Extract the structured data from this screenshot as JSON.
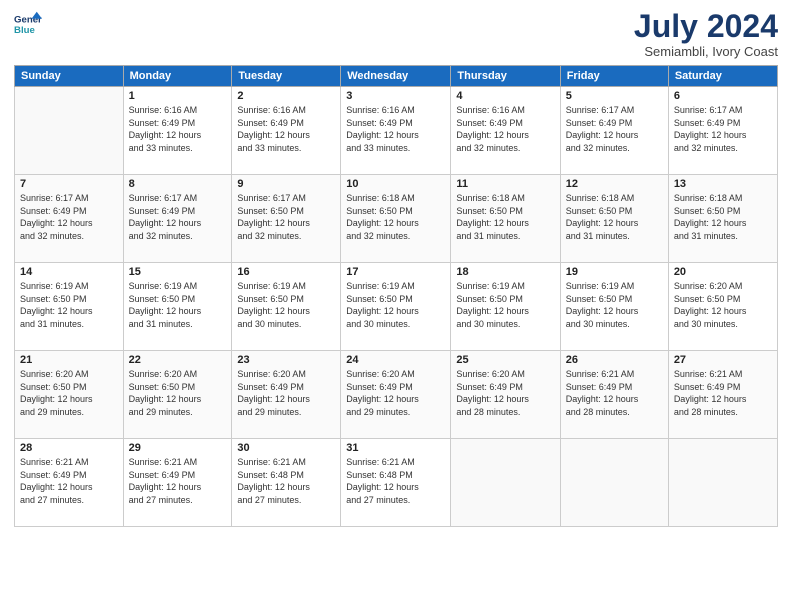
{
  "header": {
    "logo_line1": "General",
    "logo_line2": "Blue",
    "month_year": "July 2024",
    "location": "Semiambli, Ivory Coast"
  },
  "weekdays": [
    "Sunday",
    "Monday",
    "Tuesday",
    "Wednesday",
    "Thursday",
    "Friday",
    "Saturday"
  ],
  "weeks": [
    [
      {
        "day": "",
        "info": ""
      },
      {
        "day": "1",
        "info": "Sunrise: 6:16 AM\nSunset: 6:49 PM\nDaylight: 12 hours\nand 33 minutes."
      },
      {
        "day": "2",
        "info": "Sunrise: 6:16 AM\nSunset: 6:49 PM\nDaylight: 12 hours\nand 33 minutes."
      },
      {
        "day": "3",
        "info": "Sunrise: 6:16 AM\nSunset: 6:49 PM\nDaylight: 12 hours\nand 33 minutes."
      },
      {
        "day": "4",
        "info": "Sunrise: 6:16 AM\nSunset: 6:49 PM\nDaylight: 12 hours\nand 32 minutes."
      },
      {
        "day": "5",
        "info": "Sunrise: 6:17 AM\nSunset: 6:49 PM\nDaylight: 12 hours\nand 32 minutes."
      },
      {
        "day": "6",
        "info": "Sunrise: 6:17 AM\nSunset: 6:49 PM\nDaylight: 12 hours\nand 32 minutes."
      }
    ],
    [
      {
        "day": "7",
        "info": "Sunrise: 6:17 AM\nSunset: 6:49 PM\nDaylight: 12 hours\nand 32 minutes."
      },
      {
        "day": "8",
        "info": "Sunrise: 6:17 AM\nSunset: 6:49 PM\nDaylight: 12 hours\nand 32 minutes."
      },
      {
        "day": "9",
        "info": "Sunrise: 6:17 AM\nSunset: 6:50 PM\nDaylight: 12 hours\nand 32 minutes."
      },
      {
        "day": "10",
        "info": "Sunrise: 6:18 AM\nSunset: 6:50 PM\nDaylight: 12 hours\nand 32 minutes."
      },
      {
        "day": "11",
        "info": "Sunrise: 6:18 AM\nSunset: 6:50 PM\nDaylight: 12 hours\nand 31 minutes."
      },
      {
        "day": "12",
        "info": "Sunrise: 6:18 AM\nSunset: 6:50 PM\nDaylight: 12 hours\nand 31 minutes."
      },
      {
        "day": "13",
        "info": "Sunrise: 6:18 AM\nSunset: 6:50 PM\nDaylight: 12 hours\nand 31 minutes."
      }
    ],
    [
      {
        "day": "14",
        "info": "Sunrise: 6:19 AM\nSunset: 6:50 PM\nDaylight: 12 hours\nand 31 minutes."
      },
      {
        "day": "15",
        "info": "Sunrise: 6:19 AM\nSunset: 6:50 PM\nDaylight: 12 hours\nand 31 minutes."
      },
      {
        "day": "16",
        "info": "Sunrise: 6:19 AM\nSunset: 6:50 PM\nDaylight: 12 hours\nand 30 minutes."
      },
      {
        "day": "17",
        "info": "Sunrise: 6:19 AM\nSunset: 6:50 PM\nDaylight: 12 hours\nand 30 minutes."
      },
      {
        "day": "18",
        "info": "Sunrise: 6:19 AM\nSunset: 6:50 PM\nDaylight: 12 hours\nand 30 minutes."
      },
      {
        "day": "19",
        "info": "Sunrise: 6:19 AM\nSunset: 6:50 PM\nDaylight: 12 hours\nand 30 minutes."
      },
      {
        "day": "20",
        "info": "Sunrise: 6:20 AM\nSunset: 6:50 PM\nDaylight: 12 hours\nand 30 minutes."
      }
    ],
    [
      {
        "day": "21",
        "info": "Sunrise: 6:20 AM\nSunset: 6:50 PM\nDaylight: 12 hours\nand 29 minutes."
      },
      {
        "day": "22",
        "info": "Sunrise: 6:20 AM\nSunset: 6:50 PM\nDaylight: 12 hours\nand 29 minutes."
      },
      {
        "day": "23",
        "info": "Sunrise: 6:20 AM\nSunset: 6:49 PM\nDaylight: 12 hours\nand 29 minutes."
      },
      {
        "day": "24",
        "info": "Sunrise: 6:20 AM\nSunset: 6:49 PM\nDaylight: 12 hours\nand 29 minutes."
      },
      {
        "day": "25",
        "info": "Sunrise: 6:20 AM\nSunset: 6:49 PM\nDaylight: 12 hours\nand 28 minutes."
      },
      {
        "day": "26",
        "info": "Sunrise: 6:21 AM\nSunset: 6:49 PM\nDaylight: 12 hours\nand 28 minutes."
      },
      {
        "day": "27",
        "info": "Sunrise: 6:21 AM\nSunset: 6:49 PM\nDaylight: 12 hours\nand 28 minutes."
      }
    ],
    [
      {
        "day": "28",
        "info": "Sunrise: 6:21 AM\nSunset: 6:49 PM\nDaylight: 12 hours\nand 27 minutes."
      },
      {
        "day": "29",
        "info": "Sunrise: 6:21 AM\nSunset: 6:49 PM\nDaylight: 12 hours\nand 27 minutes."
      },
      {
        "day": "30",
        "info": "Sunrise: 6:21 AM\nSunset: 6:48 PM\nDaylight: 12 hours\nand 27 minutes."
      },
      {
        "day": "31",
        "info": "Sunrise: 6:21 AM\nSunset: 6:48 PM\nDaylight: 12 hours\nand 27 minutes."
      },
      {
        "day": "",
        "info": ""
      },
      {
        "day": "",
        "info": ""
      },
      {
        "day": "",
        "info": ""
      }
    ]
  ]
}
